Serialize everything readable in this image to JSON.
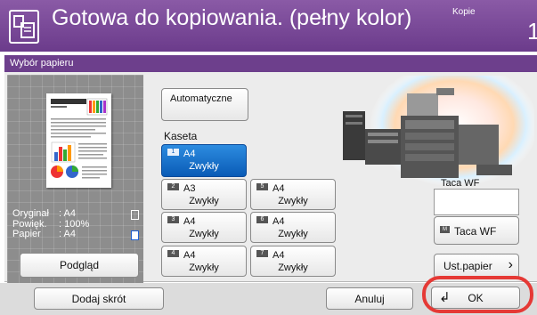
{
  "status": {
    "title": "Gotowa do kopiowania. (pełny kolor)",
    "copies_label": "Kopie",
    "copies_count": "1"
  },
  "dialog": {
    "title": "Wybór papieru"
  },
  "preview": {
    "original_label": "Oryginał",
    "original_value": ": A4",
    "zoom_label": "Powięk.",
    "zoom_value": ": 100%",
    "paper_label": "Papier",
    "paper_value": ": A4",
    "preview_button": "Podgląd"
  },
  "paper": {
    "auto_button": "Automatyczne",
    "cassette_label": "Kaseta",
    "trays": [
      {
        "num": "1",
        "size": "A4",
        "type": "Zwykły",
        "selected": true
      },
      {
        "num": "2",
        "size": "A3",
        "type": "Zwykły"
      },
      {
        "num": "3",
        "size": "A4",
        "type": "Zwykły"
      },
      {
        "num": "4",
        "size": "A4",
        "type": "Zwykły"
      },
      {
        "num": "5",
        "size": "A4",
        "type": "Zwykły"
      },
      {
        "num": "6",
        "size": "A4",
        "type": "Zwykły"
      },
      {
        "num": "7",
        "size": "A4",
        "type": "Zwykły"
      }
    ],
    "mp_tray_label": "Taca WF",
    "mp_button_tag": "M",
    "mp_button": "Taca WF",
    "paper_settings_button": "Ust.papier"
  },
  "footer": {
    "add_shortcut": "Dodaj skrót",
    "cancel": "Anuluj",
    "ok": "OK"
  },
  "colors": {
    "accent": "#6d3f8c",
    "selected": "#0a5bb6",
    "highlight_ring": "#e53935"
  }
}
